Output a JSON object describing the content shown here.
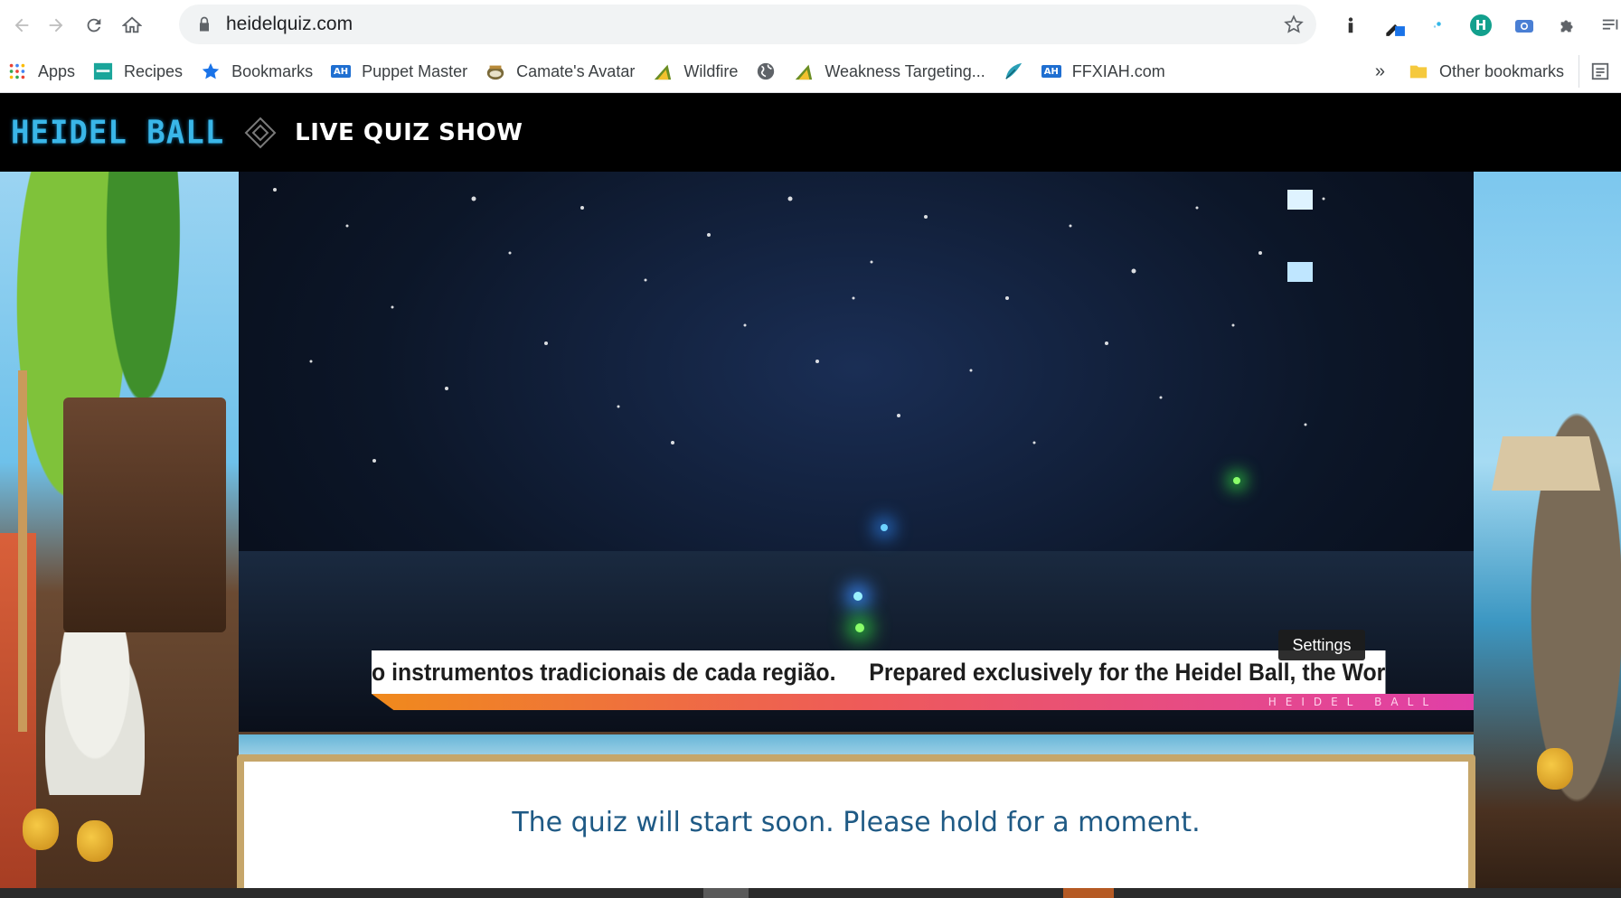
{
  "browser": {
    "url": "heidelquiz.com",
    "extensions": [
      "info-icon",
      "eyedropper-icon",
      "sparkle-icon",
      "h-avatar-icon",
      "camera-icon",
      "puzzle-icon",
      "reading-list-icon"
    ],
    "h_avatar_letter": "H"
  },
  "bookmarks": {
    "items": [
      {
        "label": "Apps",
        "icon": "apps-grid-icon"
      },
      {
        "label": "Recipes",
        "icon": "recipes-icon"
      },
      {
        "label": "Bookmarks",
        "icon": "star-icon"
      },
      {
        "label": "Puppet Master",
        "icon": "ah-icon"
      },
      {
        "label": "Camate's Avatar",
        "icon": "avatar-icon"
      },
      {
        "label": "Wildfire",
        "icon": "wildfire-icon"
      },
      {
        "label": "",
        "icon": "globe-icon"
      },
      {
        "label": "Weakness Targeting...",
        "icon": "weakness-icon"
      },
      {
        "label": "",
        "icon": "feather-icon"
      },
      {
        "label": "FFXIAH.com",
        "icon": "ah-icon"
      }
    ],
    "ah_text": "AH",
    "overflow": "»",
    "other_label": "Other bookmarks"
  },
  "site": {
    "logo": "HEIDEL BALL",
    "title": "LIVE QUIZ SHOW"
  },
  "video": {
    "ticker_text_1": "o instrumentos tradicionais de cada região.",
    "ticker_text_2": "Prepared exclusively for the Heidel Ball, the World Musi",
    "ticker_brand": "HEIDEL BALL",
    "settings_tooltip": "Settings"
  },
  "quiz": {
    "message": "The quiz will start soon. Please hold for a moment."
  },
  "colors": {
    "accent_blue": "#1f5a85",
    "logo_cyan": "#3ab6e8",
    "ticker_orange": "#f08a1c",
    "ticker_pink": "#e03fa8"
  }
}
